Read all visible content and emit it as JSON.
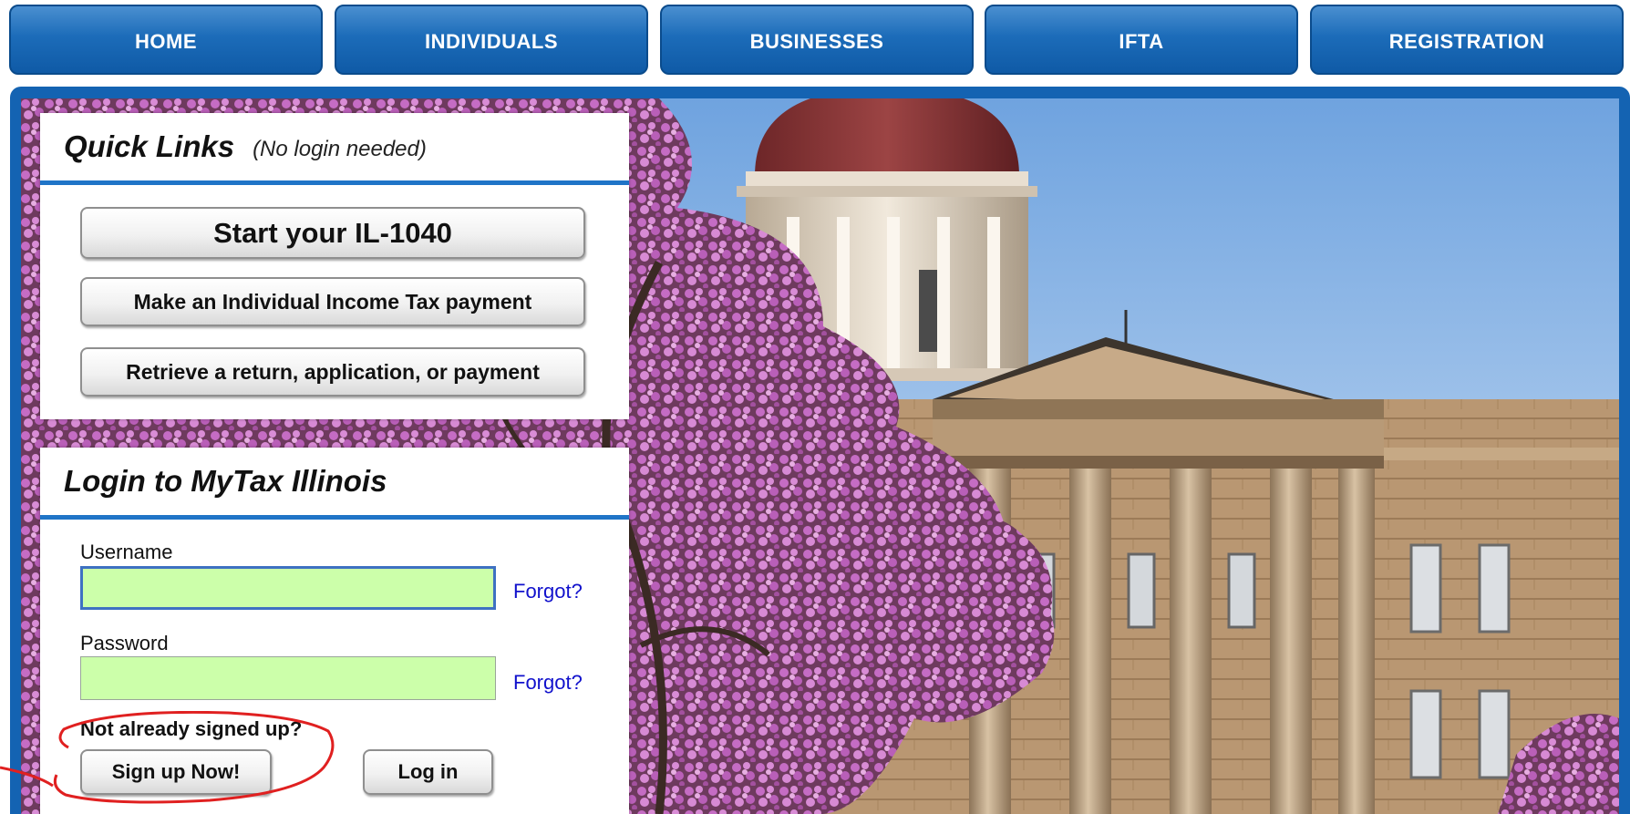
{
  "nav": {
    "tabs": [
      "HOME",
      "INDIVIDUALS",
      "BUSINESSES",
      "IFTA",
      "REGISTRATION"
    ]
  },
  "quick_links": {
    "title": "Quick Links",
    "subtitle": "(No login needed)",
    "buttons": [
      "Start your IL-1040",
      "Make an Individual Income Tax payment",
      "Retrieve a return, application, or payment"
    ]
  },
  "login": {
    "title": "Login to MyTax Illinois",
    "username_label": "Username",
    "username_value": "",
    "password_label": "Password",
    "password_value": "",
    "forgot_label": "Forgot?",
    "signup_prompt": "Not already signed up?",
    "signup_button": "Sign up Now!",
    "login_button": "Log in"
  },
  "colors": {
    "nav_blue": "#1c6cb9",
    "frame_blue": "#1463b2",
    "field_green": "#ccffaa",
    "link_blue": "#1111cc",
    "annotation_red": "#e02020"
  },
  "hero": {
    "icon": "illinois-old-state-capitol-photo"
  }
}
